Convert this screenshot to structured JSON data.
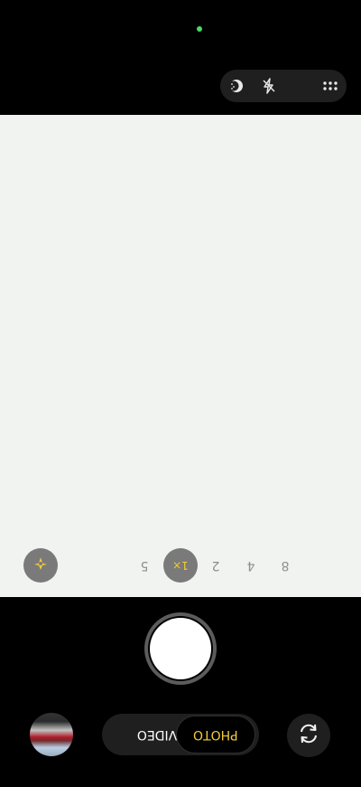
{
  "status": {
    "indicator_color": "#4cd964"
  },
  "top_controls": {
    "icons": [
      "night-mode-icon",
      "flash-off-icon",
      "more-options-icon"
    ]
  },
  "zoom": {
    "options": [
      "5",
      "1×",
      "2",
      "4",
      "8"
    ],
    "selected": "1×"
  },
  "modes": {
    "video_label": "VIDEO",
    "photo_label": "PHOTO",
    "selected": "PHOTO"
  },
  "colors": {
    "accent": "#f4cd37",
    "viewfinder_bg": "#f1f3f1",
    "control_bg": "#1f1f1f"
  }
}
